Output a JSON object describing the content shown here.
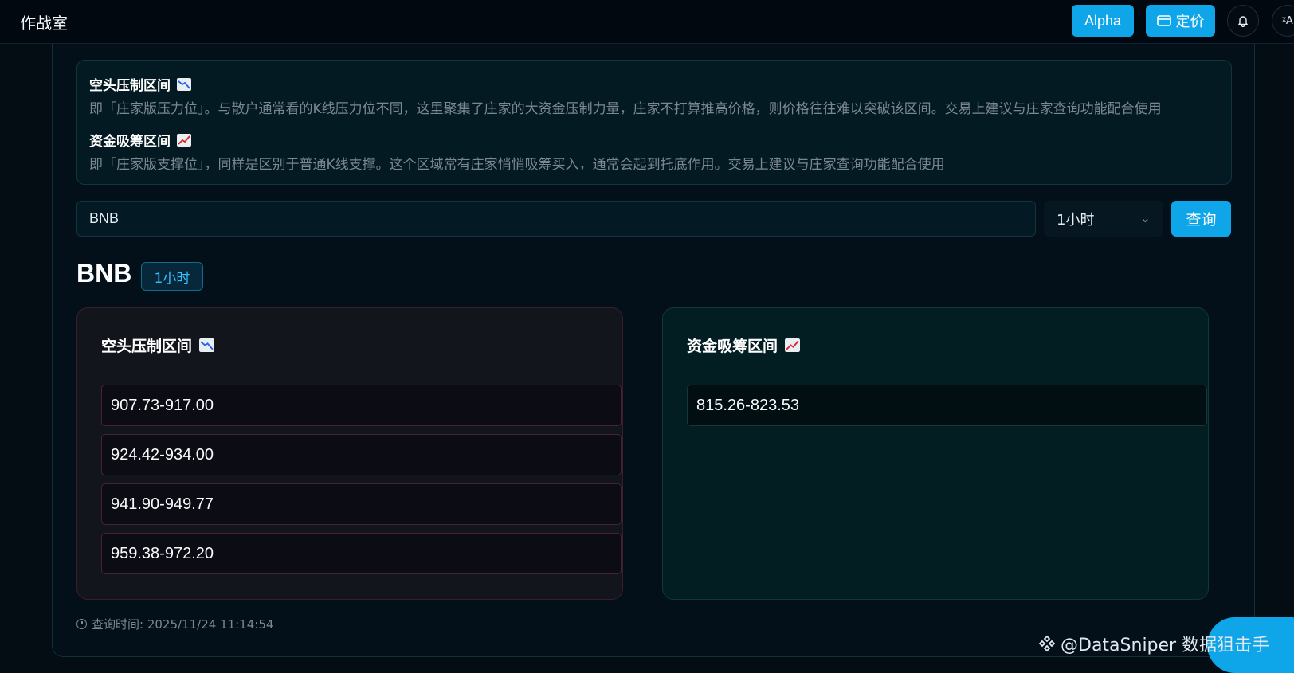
{
  "header": {
    "brand": "作战室",
    "alpha_label": "Alpha",
    "pricing_label": "定价"
  },
  "info": {
    "short_title": "空头压制区间",
    "short_desc": "即「庄家版压力位」。与散户通常看的K线压力位不同，这里聚集了庄家的大资金压制力量，庄家不打算推高价格，则价格往往难以突破该区间。交易上建议与庄家查询功能配合使用",
    "long_title": "资金吸筹区间",
    "long_desc": "即「庄家版支撑位」，同样是区别于普通K线支撑。这个区域常有庄家悄悄吸筹买入，通常会起到托底作用。交易上建议与庄家查询功能配合使用"
  },
  "search": {
    "value": "BNB",
    "timeframe": "1小时",
    "query_label": "查询"
  },
  "result": {
    "symbol": "BNB",
    "timeframe": "1小时",
    "short_title": "空头压制区间",
    "short_zones": [
      "907.73-917.00",
      "924.42-934.00",
      "941.90-949.77",
      "959.38-972.20"
    ],
    "long_title": "资金吸筹区间",
    "long_zones": [
      "815.26-823.53"
    ],
    "query_time": "查询时间: 2025/11/24 11:14:54"
  },
  "watermark": "@DataSniper 数据狙击手",
  "colors": {
    "accent": "#0ea5e9",
    "background": "#040c14"
  }
}
